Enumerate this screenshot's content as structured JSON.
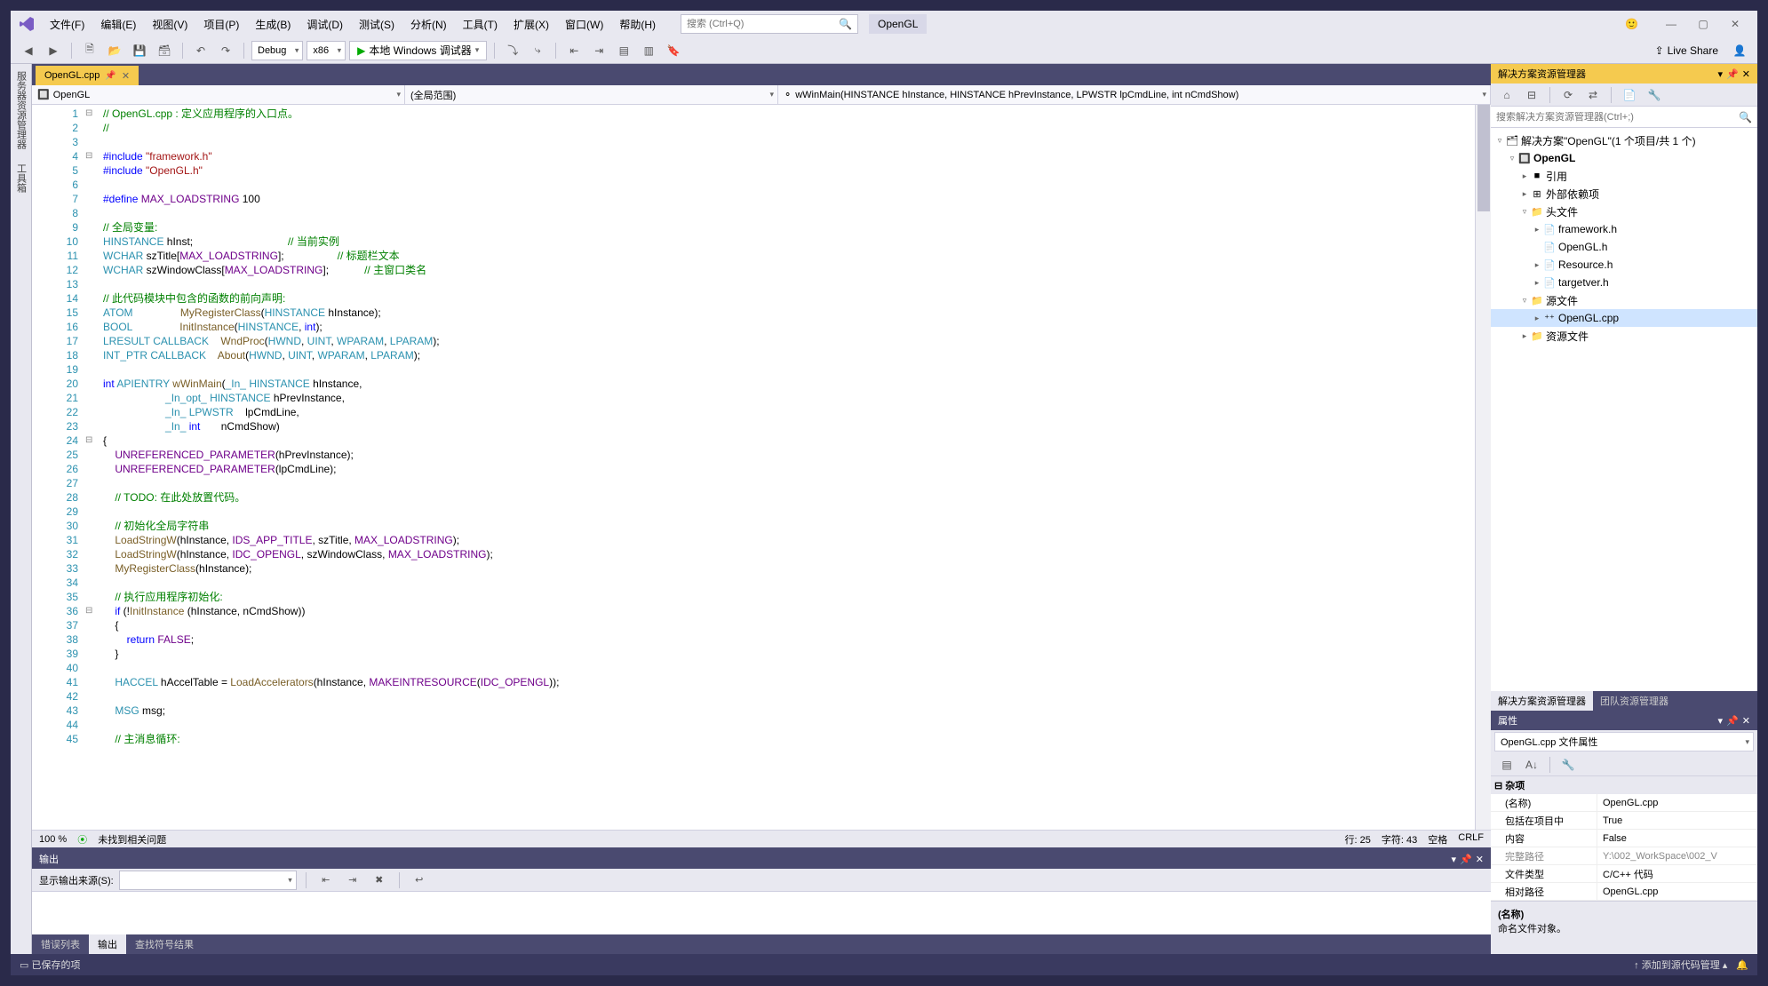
{
  "menu": [
    "文件(F)",
    "编辑(E)",
    "视图(V)",
    "项目(P)",
    "生成(B)",
    "调试(D)",
    "测试(S)",
    "分析(N)",
    "工具(T)",
    "扩展(X)",
    "窗口(W)",
    "帮助(H)"
  ],
  "search_placeholder": "搜索 (Ctrl+Q)",
  "solution_name": "OpenGL",
  "toolbar": {
    "config": "Debug",
    "platform": "x86",
    "run_label": "本地 Windows 调试器",
    "live_share": "Live Share"
  },
  "left_dock": [
    "服务器资源管理器",
    "工具箱"
  ],
  "editor_tab": "OpenGL.cpp",
  "nav": {
    "project": "OpenGL",
    "scope": "(全局范围)",
    "member": "wWinMain(HINSTANCE hInstance, HINSTANCE hPrevInstance, LPWSTR lpCmdLine, int nCmdShow)"
  },
  "code_lines": [
    {
      "n": 1,
      "f": "⊟",
      "html": "<span class='c-comment'>// OpenGL.cpp : 定义应用程序的入口点。</span>"
    },
    {
      "n": 2,
      "f": "",
      "html": "<span class='c-comment'>//</span>"
    },
    {
      "n": 3,
      "f": "",
      "html": ""
    },
    {
      "n": 4,
      "f": "⊟",
      "html": "<span class='c-keyword'>#include</span> <span class='c-string'>\"framework.h\"</span>"
    },
    {
      "n": 5,
      "f": "",
      "html": "<span class='c-keyword'>#include</span> <span class='c-string'>\"OpenGL.h\"</span>"
    },
    {
      "n": 6,
      "f": "",
      "html": ""
    },
    {
      "n": 7,
      "f": "",
      "html": "<span class='c-keyword'>#define</span> <span class='c-macro'>MAX_LOADSTRING</span> 100"
    },
    {
      "n": 8,
      "f": "",
      "html": ""
    },
    {
      "n": 9,
      "f": "",
      "html": "<span class='c-comment'>// 全局变量:</span>"
    },
    {
      "n": 10,
      "f": "",
      "html": "<span class='c-type'>HINSTANCE</span> hInst;                                <span class='c-comment'>// 当前实例</span>"
    },
    {
      "n": 11,
      "f": "",
      "html": "<span class='c-type'>WCHAR</span> szTitle[<span class='c-macro'>MAX_LOADSTRING</span>];                  <span class='c-comment'>// 标题栏文本</span>"
    },
    {
      "n": 12,
      "f": "",
      "html": "<span class='c-type'>WCHAR</span> szWindowClass[<span class='c-macro'>MAX_LOADSTRING</span>];            <span class='c-comment'>// 主窗口类名</span>"
    },
    {
      "n": 13,
      "f": "",
      "html": ""
    },
    {
      "n": 14,
      "f": "",
      "html": "<span class='c-comment'>// 此代码模块中包含的函数的前向声明:</span>"
    },
    {
      "n": 15,
      "f": "",
      "html": "<span class='c-type'>ATOM</span>                <span class='c-func'>MyRegisterClass</span>(<span class='c-type'>HINSTANCE</span> hInstance);"
    },
    {
      "n": 16,
      "f": "",
      "html": "<span class='c-type'>BOOL</span>                <span class='c-func'>InitInstance</span>(<span class='c-type'>HINSTANCE</span>, <span class='c-keyword'>int</span>);"
    },
    {
      "n": 17,
      "f": "",
      "html": "<span class='c-type'>LRESULT</span> <span class='c-type'>CALLBACK</span>    <span class='c-func'>WndProc</span>(<span class='c-type'>HWND</span>, <span class='c-type'>UINT</span>, <span class='c-type'>WPARAM</span>, <span class='c-type'>LPARAM</span>);"
    },
    {
      "n": 18,
      "f": "",
      "html": "<span class='c-type'>INT_PTR</span> <span class='c-type'>CALLBACK</span>    <span class='c-func'>About</span>(<span class='c-type'>HWND</span>, <span class='c-type'>UINT</span>, <span class='c-type'>WPARAM</span>, <span class='c-type'>LPARAM</span>);"
    },
    {
      "n": 19,
      "f": "",
      "html": ""
    },
    {
      "n": 20,
      "f": "",
      "html": "<span class='c-keyword'>int</span> <span class='c-type'>APIENTRY</span> <span class='c-func'>wWinMain</span>(<span class='c-type'>_In_</span> <span class='c-type'>HINSTANCE</span> hInstance,"
    },
    {
      "n": 21,
      "f": "",
      "html": "                     <span class='c-type'>_In_opt_</span> <span class='c-type'>HINSTANCE</span> hPrevInstance,"
    },
    {
      "n": 22,
      "f": "",
      "html": "                     <span class='c-type'>_In_</span> <span class='c-type'>LPWSTR</span>    lpCmdLine,"
    },
    {
      "n": 23,
      "f": "",
      "html": "                     <span class='c-type'>_In_</span> <span class='c-keyword'>int</span>       nCmdShow)"
    },
    {
      "n": 24,
      "f": "⊟",
      "html": "{"
    },
    {
      "n": 25,
      "f": "",
      "html": "    <span class='c-macro'>UNREFERENCED_PARAMETER</span>(hPrevInstance);"
    },
    {
      "n": 26,
      "f": "",
      "html": "    <span class='c-macro'>UNREFERENCED_PARAMETER</span>(lpCmdLine);"
    },
    {
      "n": 27,
      "f": "",
      "html": ""
    },
    {
      "n": 28,
      "f": "",
      "html": "    <span class='c-comment'>// TODO: 在此处放置代码。</span>"
    },
    {
      "n": 29,
      "f": "",
      "html": ""
    },
    {
      "n": 30,
      "f": "",
      "html": "    <span class='c-comment'>// 初始化全局字符串</span>"
    },
    {
      "n": 31,
      "f": "",
      "html": "    <span class='c-func'>LoadStringW</span>(hInstance, <span class='c-macro'>IDS_APP_TITLE</span>, szTitle, <span class='c-macro'>MAX_LOADSTRING</span>);"
    },
    {
      "n": 32,
      "f": "",
      "html": "    <span class='c-func'>LoadStringW</span>(hInstance, <span class='c-macro'>IDC_OPENGL</span>, szWindowClass, <span class='c-macro'>MAX_LOADSTRING</span>);"
    },
    {
      "n": 33,
      "f": "",
      "html": "    <span class='c-func'>MyRegisterClass</span>(hInstance);"
    },
    {
      "n": 34,
      "f": "",
      "html": ""
    },
    {
      "n": 35,
      "f": "",
      "html": "    <span class='c-comment'>// 执行应用程序初始化:</span>"
    },
    {
      "n": 36,
      "f": "⊟",
      "html": "    <span class='c-keyword'>if</span> (!<span class='c-func'>InitInstance</span> (hInstance, nCmdShow))"
    },
    {
      "n": 37,
      "f": "",
      "html": "    {"
    },
    {
      "n": 38,
      "f": "",
      "html": "        <span class='c-keyword'>return</span> <span class='c-macro'>FALSE</span>;"
    },
    {
      "n": 39,
      "f": "",
      "html": "    }"
    },
    {
      "n": 40,
      "f": "",
      "html": ""
    },
    {
      "n": 41,
      "f": "",
      "html": "    <span class='c-type'>HACCEL</span> hAccelTable = <span class='c-func'>LoadAccelerators</span>(hInstance, <span class='c-macro'>MAKEINTRESOURCE</span>(<span class='c-macro'>IDC_OPENGL</span>));"
    },
    {
      "n": 42,
      "f": "",
      "html": ""
    },
    {
      "n": 43,
      "f": "",
      "html": "    <span class='c-type'>MSG</span> msg;"
    },
    {
      "n": 44,
      "f": "",
      "html": ""
    },
    {
      "n": 45,
      "f": "",
      "html": "    <span class='c-comment'>// 主消息循环:</span>"
    }
  ],
  "editor_status": {
    "zoom": "100 %",
    "issues": "未找到相关问题",
    "line": "行: 25",
    "col": "字符: 43",
    "ins": "空格",
    "eol": "CRLF"
  },
  "output": {
    "title": "输出",
    "source_label": "显示输出来源(S):",
    "tabs": [
      "错误列表",
      "输出",
      "查找符号结果"
    ],
    "active_tab": 1
  },
  "solution_explorer": {
    "title": "解决方案资源管理器",
    "search_placeholder": "搜索解决方案资源管理器(Ctrl+;)",
    "root": "解决方案\"OpenGL\"(1 个项目/共 1 个)",
    "project": "OpenGL",
    "nodes": [
      {
        "depth": 2,
        "exp": "▸",
        "icon": "■",
        "label": "引用"
      },
      {
        "depth": 2,
        "exp": "▸",
        "icon": "⊞",
        "label": "外部依赖项"
      },
      {
        "depth": 2,
        "exp": "▿",
        "icon": "📁",
        "label": "头文件"
      },
      {
        "depth": 3,
        "exp": "▸",
        "icon": "📄",
        "label": "framework.h"
      },
      {
        "depth": 3,
        "exp": "",
        "icon": "📄",
        "label": "OpenGL.h"
      },
      {
        "depth": 3,
        "exp": "▸",
        "icon": "📄",
        "label": "Resource.h"
      },
      {
        "depth": 3,
        "exp": "▸",
        "icon": "📄",
        "label": "targetver.h"
      },
      {
        "depth": 2,
        "exp": "▿",
        "icon": "📁",
        "label": "源文件"
      },
      {
        "depth": 3,
        "exp": "▸",
        "icon": "⁺⁺",
        "label": "OpenGL.cpp",
        "sel": true
      },
      {
        "depth": 2,
        "exp": "▸",
        "icon": "📁",
        "label": "资源文件"
      }
    ],
    "tabs": [
      "解决方案资源管理器",
      "团队资源管理器"
    ]
  },
  "properties": {
    "title": "属性",
    "target": "OpenGL.cpp 文件属性",
    "category": "杂项",
    "rows": [
      {
        "name": "(名称)",
        "val": "OpenGL.cpp"
      },
      {
        "name": "包括在项目中",
        "val": "True"
      },
      {
        "name": "内容",
        "val": "False"
      },
      {
        "name": "完整路径",
        "val": "Y:\\002_WorkSpace\\002_V",
        "ro": true
      },
      {
        "name": "文件类型",
        "val": "C/C++ 代码"
      },
      {
        "name": "相对路径",
        "val": "OpenGL.cpp"
      }
    ],
    "desc_title": "(名称)",
    "desc_body": "命名文件对象。"
  },
  "statusbar": {
    "left": "已保存的项",
    "right": "添加到源代码管理"
  }
}
